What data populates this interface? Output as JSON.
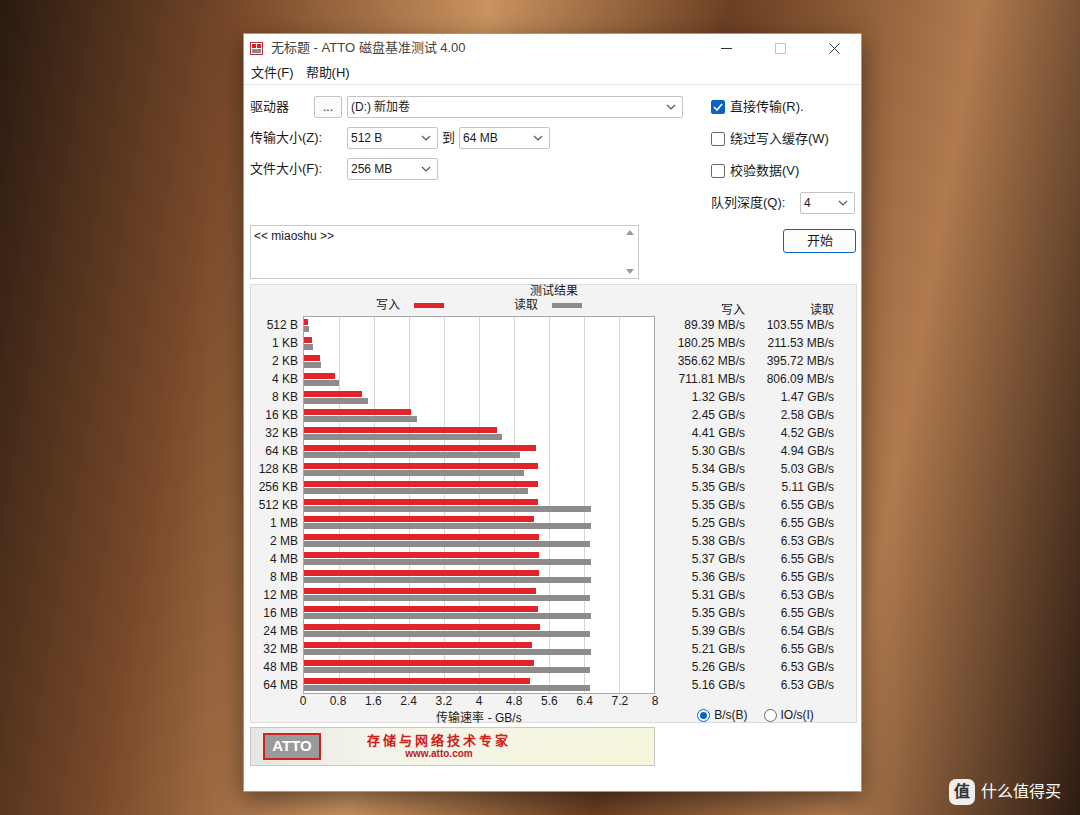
{
  "window": {
    "title": "无标题 - ATTO 磁盘基准测试 4.00",
    "maximize": {
      "disabled": true
    }
  },
  "menu": [
    "文件(F)",
    "帮助(H)"
  ],
  "settings": {
    "drive": {
      "label": "驱动器",
      "browse": "...",
      "value": "(D:) 新加卷"
    },
    "transfer_size": {
      "label": "传输大小(Z):",
      "from": "512 B",
      "to_label": "到",
      "to": "64 MB"
    },
    "file_size": {
      "label": "文件大小(F):",
      "value": "256 MB"
    },
    "options": [
      {
        "label": "直接传输(R).",
        "checked": true
      },
      {
        "label": "绕过写入缓存(W)",
        "checked": false
      },
      {
        "label": "校验数据(V)",
        "checked": false
      }
    ],
    "queue_depth": {
      "label": "队列深度(Q):",
      "value": "4"
    },
    "description": "<< miaoshu >>",
    "start_button": "开始"
  },
  "results": {
    "title": "测试结果",
    "chart": {
      "rows": [
        "512 B",
        "1 KB",
        "2 KB",
        "4 KB",
        "8 KB",
        "16 KB",
        "32 KB",
        "64 KB",
        "128 KB",
        "256 KB",
        "512 KB",
        "1 MB",
        "2 MB",
        "4 MB",
        "8 MB",
        "12 MB",
        "16 MB",
        "24 MB",
        "32 MB",
        "48 MB",
        "64 MB"
      ],
      "series": [
        {
          "label": "写入",
          "color": "#e0242c",
          "values": [
            0.08939,
            0.18025,
            0.35662,
            0.71181,
            1.32,
            2.45,
            4.41,
            5.3,
            5.34,
            5.35,
            5.35,
            5.25,
            5.38,
            5.37,
            5.36,
            5.31,
            5.35,
            5.39,
            5.21,
            5.26,
            5.16
          ]
        },
        {
          "label": "读取",
          "color": "#8c8c8c",
          "values": [
            0.10355,
            0.21153,
            0.39572,
            0.80609,
            1.47,
            2.58,
            4.52,
            4.94,
            5.03,
            5.11,
            6.55,
            6.55,
            6.53,
            6.55,
            6.55,
            6.53,
            6.55,
            6.54,
            6.55,
            6.53,
            6.53
          ]
        }
      ],
      "x_ticks": [
        "0",
        "0.8",
        "1.6",
        "2.4",
        "3.2",
        "4",
        "4.8",
        "5.6",
        "6.4",
        "7.2",
        "8"
      ],
      "x_axis_title": "传输速率 - GB/s"
    },
    "table": {
      "columns": [
        "写入",
        "读取"
      ],
      "rows": [
        [
          "89.39 MB/s",
          "103.55 MB/s"
        ],
        [
          "180.25 MB/s",
          "211.53 MB/s"
        ],
        [
          "356.62 MB/s",
          "395.72 MB/s"
        ],
        [
          "711.81 MB/s",
          "806.09 MB/s"
        ],
        [
          "1.32 GB/s",
          "1.47 GB/s"
        ],
        [
          "2.45 GB/s",
          "2.58 GB/s"
        ],
        [
          "4.41 GB/s",
          "4.52 GB/s"
        ],
        [
          "5.30 GB/s",
          "4.94 GB/s"
        ],
        [
          "5.34 GB/s",
          "5.03 GB/s"
        ],
        [
          "5.35 GB/s",
          "5.11 GB/s"
        ],
        [
          "5.35 GB/s",
          "6.55 GB/s"
        ],
        [
          "5.25 GB/s",
          "6.55 GB/s"
        ],
        [
          "5.38 GB/s",
          "6.53 GB/s"
        ],
        [
          "5.37 GB/s",
          "6.55 GB/s"
        ],
        [
          "5.36 GB/s",
          "6.55 GB/s"
        ],
        [
          "5.31 GB/s",
          "6.53 GB/s"
        ],
        [
          "5.35 GB/s",
          "6.55 GB/s"
        ],
        [
          "5.39 GB/s",
          "6.54 GB/s"
        ],
        [
          "5.21 GB/s",
          "6.55 GB/s"
        ],
        [
          "5.26 GB/s",
          "6.53 GB/s"
        ],
        [
          "5.16 GB/s",
          "6.53 GB/s"
        ]
      ]
    },
    "units": [
      {
        "label": "B/s(B)",
        "selected": true
      },
      {
        "label": "IO/s(I)",
        "selected": false
      }
    ]
  },
  "banner": {
    "logo": "ATTO",
    "slogan": "存储与网络技术专家",
    "url": "www.atto.com"
  },
  "watermark": {
    "logo": "值",
    "text": "什么值得买"
  }
}
